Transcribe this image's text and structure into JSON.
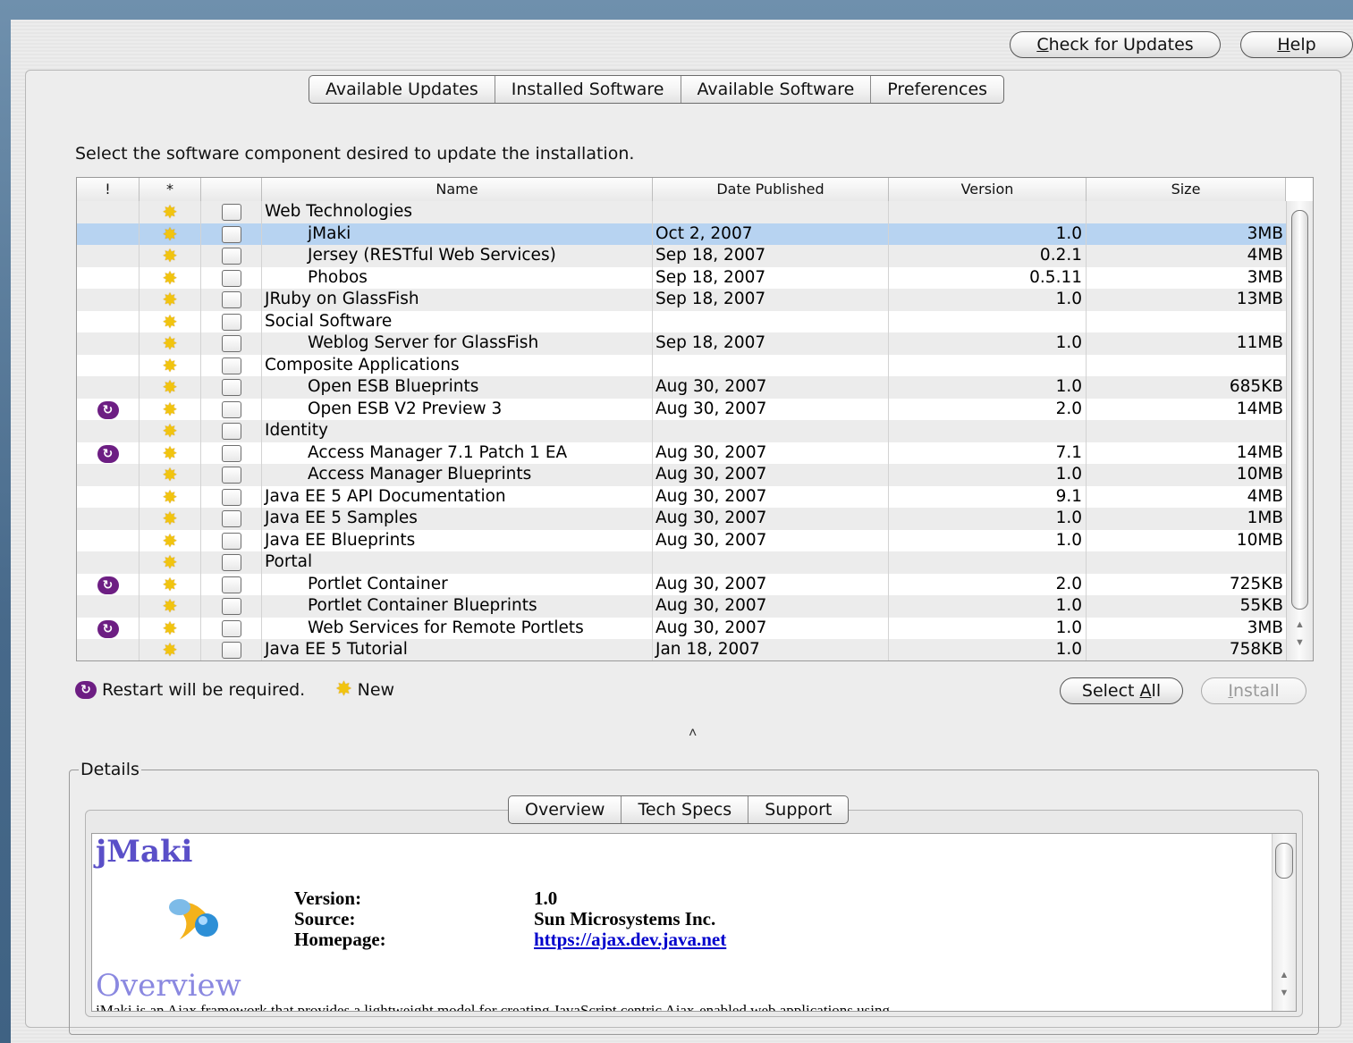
{
  "toolbar": {
    "check_updates_prefix": "C",
    "check_updates_rest": "heck for Updates",
    "help_prefix": "H",
    "help_rest": "elp"
  },
  "tabs": [
    "Available Updates",
    "Installed Software",
    "Available Software",
    "Preferences"
  ],
  "instruction": "Select the software component desired to update the installation.",
  "table": {
    "headers": [
      "!",
      "*",
      "",
      "Name",
      "Date Published",
      "Version",
      "Size"
    ],
    "rows": [
      {
        "restart": false,
        "new": true,
        "indent": false,
        "name": "Web Technologies",
        "date": "",
        "version": "",
        "size": ""
      },
      {
        "restart": false,
        "new": true,
        "indent": true,
        "name": "jMaki",
        "date": "Oct 2, 2007",
        "version": "1.0",
        "size": "3MB",
        "selected": true
      },
      {
        "restart": false,
        "new": true,
        "indent": true,
        "name": "Jersey (RESTful Web Services)",
        "date": "Sep 18, 2007",
        "version": "0.2.1",
        "size": "4MB"
      },
      {
        "restart": false,
        "new": true,
        "indent": true,
        "name": "Phobos",
        "date": "Sep 18, 2007",
        "version": "0.5.11",
        "size": "3MB"
      },
      {
        "restart": false,
        "new": true,
        "indent": false,
        "name": "JRuby on GlassFish",
        "date": "Sep 18, 2007",
        "version": "1.0",
        "size": "13MB"
      },
      {
        "restart": false,
        "new": true,
        "indent": false,
        "name": "Social Software",
        "date": "",
        "version": "",
        "size": ""
      },
      {
        "restart": false,
        "new": true,
        "indent": true,
        "name": "Weblog Server for GlassFish",
        "date": "Sep 18, 2007",
        "version": "1.0",
        "size": "11MB"
      },
      {
        "restart": false,
        "new": true,
        "indent": false,
        "name": "Composite Applications",
        "date": "",
        "version": "",
        "size": ""
      },
      {
        "restart": false,
        "new": true,
        "indent": true,
        "name": "Open ESB Blueprints",
        "date": "Aug 30, 2007",
        "version": "1.0",
        "size": "685KB"
      },
      {
        "restart": true,
        "new": true,
        "indent": true,
        "name": "Open ESB V2 Preview 3",
        "date": "Aug 30, 2007",
        "version": "2.0",
        "size": "14MB"
      },
      {
        "restart": false,
        "new": true,
        "indent": false,
        "name": "Identity",
        "date": "",
        "version": "",
        "size": ""
      },
      {
        "restart": true,
        "new": true,
        "indent": true,
        "name": "Access Manager 7.1 Patch 1 EA",
        "date": "Aug 30, 2007",
        "version": "7.1",
        "size": "14MB"
      },
      {
        "restart": false,
        "new": true,
        "indent": true,
        "name": "Access Manager Blueprints",
        "date": "Aug 30, 2007",
        "version": "1.0",
        "size": "10MB"
      },
      {
        "restart": false,
        "new": true,
        "indent": false,
        "name": "Java EE 5 API Documentation",
        "date": "Aug 30, 2007",
        "version": "9.1",
        "size": "4MB"
      },
      {
        "restart": false,
        "new": true,
        "indent": false,
        "name": "Java EE 5 Samples",
        "date": "Aug 30, 2007",
        "version": "1.0",
        "size": "1MB"
      },
      {
        "restart": false,
        "new": true,
        "indent": false,
        "name": "Java EE Blueprints",
        "date": "Aug 30, 2007",
        "version": "1.0",
        "size": "10MB"
      },
      {
        "restart": false,
        "new": true,
        "indent": false,
        "name": "Portal",
        "date": "",
        "version": "",
        "size": ""
      },
      {
        "restart": true,
        "new": true,
        "indent": true,
        "name": "Portlet Container",
        "date": "Aug 30, 2007",
        "version": "2.0",
        "size": "725KB"
      },
      {
        "restart": false,
        "new": true,
        "indent": true,
        "name": "Portlet Container Blueprints",
        "date": "Aug 30, 2007",
        "version": "1.0",
        "size": "55KB"
      },
      {
        "restart": true,
        "new": true,
        "indent": true,
        "name": "Web Services for Remote Portlets",
        "date": "Aug 30, 2007",
        "version": "1.0",
        "size": "3MB"
      },
      {
        "restart": false,
        "new": true,
        "indent": false,
        "name": "Java EE 5 Tutorial",
        "date": "Jan 18, 2007",
        "version": "1.0",
        "size": "758KB"
      }
    ]
  },
  "legend": {
    "restart_label": "Restart will be required.",
    "new_label": "New"
  },
  "actions": {
    "select_all_prefix": "Select ",
    "select_all_accel": "A",
    "select_all_rest": "ll",
    "install_prefix": "I",
    "install_rest": "nstall"
  },
  "details": {
    "label": "Details",
    "tabs": [
      "Overview",
      "Tech Specs",
      "Support"
    ],
    "title": "jMaki",
    "fields": [
      {
        "label": "Version:",
        "value": "1.0"
      },
      {
        "label": "Source:",
        "value": "Sun Microsystems Inc."
      },
      {
        "label": "Homepage:",
        "value": "https://ajax.dev.java.net"
      }
    ],
    "overview_heading": "Overview",
    "overview_text": "jMaki is an Ajax framework that provides a lightweight model for creating JavaScript centric Ajax-enabled web applications using"
  },
  "colors": {
    "restart_icon": "#6d1e83",
    "new_icon": "#f1c40f",
    "selection": "#b7d3f1",
    "title_color": "#5a4fc8"
  }
}
